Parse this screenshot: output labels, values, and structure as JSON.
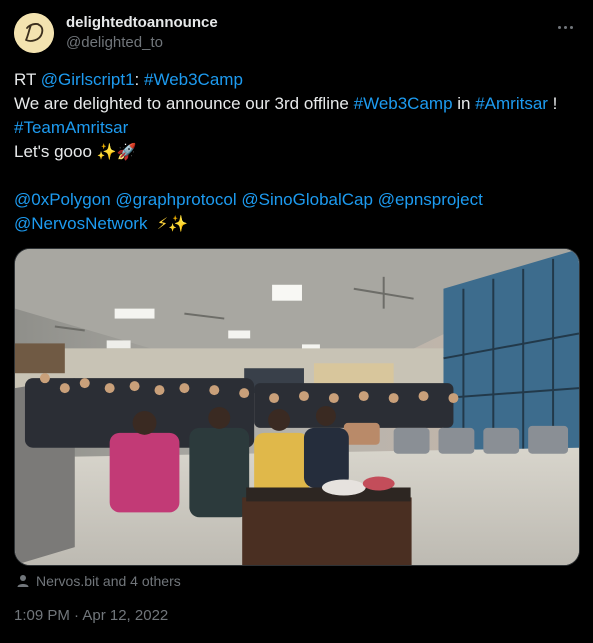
{
  "author": {
    "display_name": "delightedtoannounce",
    "handle": "@delighted_to",
    "avatar_letter": "D"
  },
  "tweet": {
    "line1": {
      "prefix": "RT ",
      "mention": "@Girlscript1",
      "sep": ": ",
      "hashtag": "#Web3Camp"
    },
    "line2": {
      "text1": "We are delighted to announce our 3rd offline ",
      "hashtag1": "#Web3Camp",
      "text2": " in ",
      "hashtag2": "#Amritsar",
      "text3": " !"
    },
    "line3": {
      "hashtag": "#TeamAmritsar"
    },
    "line4": {
      "text": "Let's gooo ",
      "emoji_sparkles": "✨",
      "emoji_rocket": "🚀"
    },
    "line5": {
      "m1": "@0xPolygon",
      "m2": "@graphprotocol",
      "m3": "@SinoGlobalCap",
      "m4": "@epnsproject"
    },
    "line6": {
      "m5": "@NervosNetwork",
      "emoji_bolt": "⚡",
      "emoji_sparkles": "✨"
    }
  },
  "social_context": {
    "text": "Nervos.bit and 4 others"
  },
  "timestamp": "1:09 PM · Apr 12, 2022",
  "colors": {
    "link": "#1d9bf0",
    "secondary": "#71767b",
    "background": "#000000",
    "text": "#e7e9ea"
  },
  "icons": {
    "more": "more-icon",
    "person": "person-icon"
  }
}
